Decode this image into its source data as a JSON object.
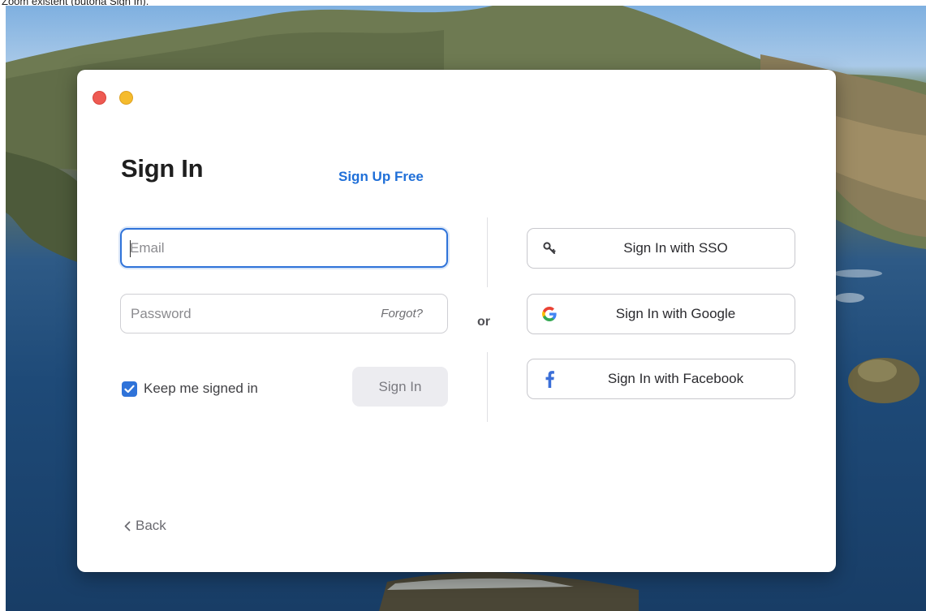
{
  "caption": "Zoom existent (butonă Sign In).",
  "window": {
    "title": "Sign In",
    "signup_link": "Sign Up Free"
  },
  "form": {
    "email_placeholder": "Email",
    "email_value": "",
    "password_placeholder": "Password",
    "password_value": "",
    "forgot_label": "Forgot?",
    "keep_signed_in_label": "Keep me signed in",
    "keep_signed_in_checked": true,
    "signin_label": "Sign In"
  },
  "separator": {
    "or_label": "or"
  },
  "social": [
    {
      "label": "Sign In with SSO",
      "icon": "key-icon"
    },
    {
      "label": "Sign In with Google",
      "icon": "google-icon"
    },
    {
      "label": "Sign In with Facebook",
      "icon": "facebook-icon"
    }
  ],
  "footer": {
    "back_label": "Back"
  },
  "colors": {
    "accent": "#2f73d9",
    "link": "#1f6fd8",
    "close": "#ee5a52",
    "minimize": "#f5bb2c",
    "facebook": "#3b6fd8"
  }
}
